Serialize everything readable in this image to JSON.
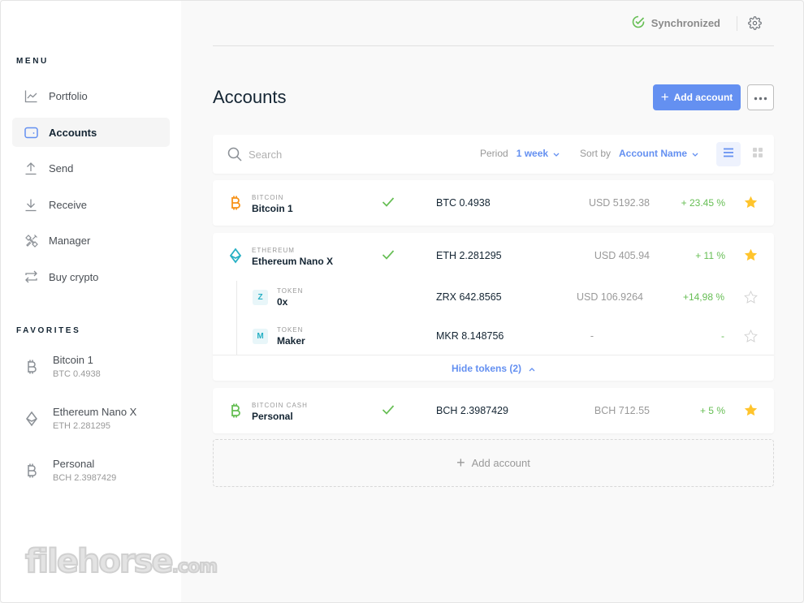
{
  "sidebar": {
    "menu_title": "MENU",
    "menu": [
      {
        "label": "Portfolio",
        "icon": "chart-line-icon"
      },
      {
        "label": "Accounts",
        "icon": "wallet-icon",
        "active": true
      },
      {
        "label": "Send",
        "icon": "arrow-up-icon"
      },
      {
        "label": "Receive",
        "icon": "arrow-down-icon"
      },
      {
        "label": "Manager",
        "icon": "tools-icon"
      },
      {
        "label": "Buy crypto",
        "icon": "exchange-icon"
      }
    ],
    "favorites_title": "FAVORITES",
    "favorites": [
      {
        "name": "Bitcoin 1",
        "balance": "BTC 0.4938",
        "icon": "bitcoin-icon"
      },
      {
        "name": "Ethereum Nano X",
        "balance": "ETH 2.281295",
        "icon": "ethereum-icon"
      },
      {
        "name": "Personal",
        "balance": "BCH 2.3987429",
        "icon": "bitcoin-cash-icon"
      }
    ]
  },
  "watermark": {
    "main": "filehorse",
    "suffix": ".com"
  },
  "topbar": {
    "sync_status": "Synchronized",
    "sync_color": "#66be54"
  },
  "page": {
    "title": "Accounts",
    "add_account_label": "Add account",
    "more_label": "•••"
  },
  "toolbar": {
    "search_placeholder": "Search",
    "search_value": "",
    "period_label": "Period",
    "period_value": "1 week",
    "sort_label": "Sort by",
    "sort_value": "Account Name",
    "view_mode": "list"
  },
  "accounts": [
    {
      "currency": "BITCOIN",
      "name": "Bitcoin 1",
      "synced": true,
      "balance": "BTC 0.4938",
      "fiat": "USD 5192.38",
      "change": "+ 23.45 %",
      "favorite": true,
      "color": "#f7931a"
    },
    {
      "currency": "ETHEREUM",
      "name": "Ethereum Nano X",
      "synced": true,
      "balance": "ETH 2.281295",
      "fiat": "USD 405.94",
      "change": "+ 11 %",
      "favorite": true,
      "color": "#27b0c4",
      "tokens": [
        {
          "letter": "Z",
          "type": "TOKEN",
          "name": "0x",
          "balance": "ZRX 642.8565",
          "fiat": "USD 106.9264",
          "change": "+14,98 %",
          "favorite": false
        },
        {
          "letter": "M",
          "type": "TOKEN",
          "name": "Maker",
          "balance": "MKR 8.148756",
          "fiat": "-",
          "change": "-",
          "favorite": false
        }
      ],
      "hide_tokens_label": "Hide tokens (2)"
    },
    {
      "currency": "BITCOIN CASH",
      "name": "Personal",
      "synced": true,
      "balance": "BCH 2.3987429",
      "fiat": "BCH 712.55",
      "change": "+ 5 %",
      "favorite": true,
      "color": "#66be54"
    }
  ],
  "add_account_row_label": "Add account",
  "colors": {
    "accent": "#6490f1",
    "positive": "#66be54",
    "star": "#ffc42c"
  }
}
